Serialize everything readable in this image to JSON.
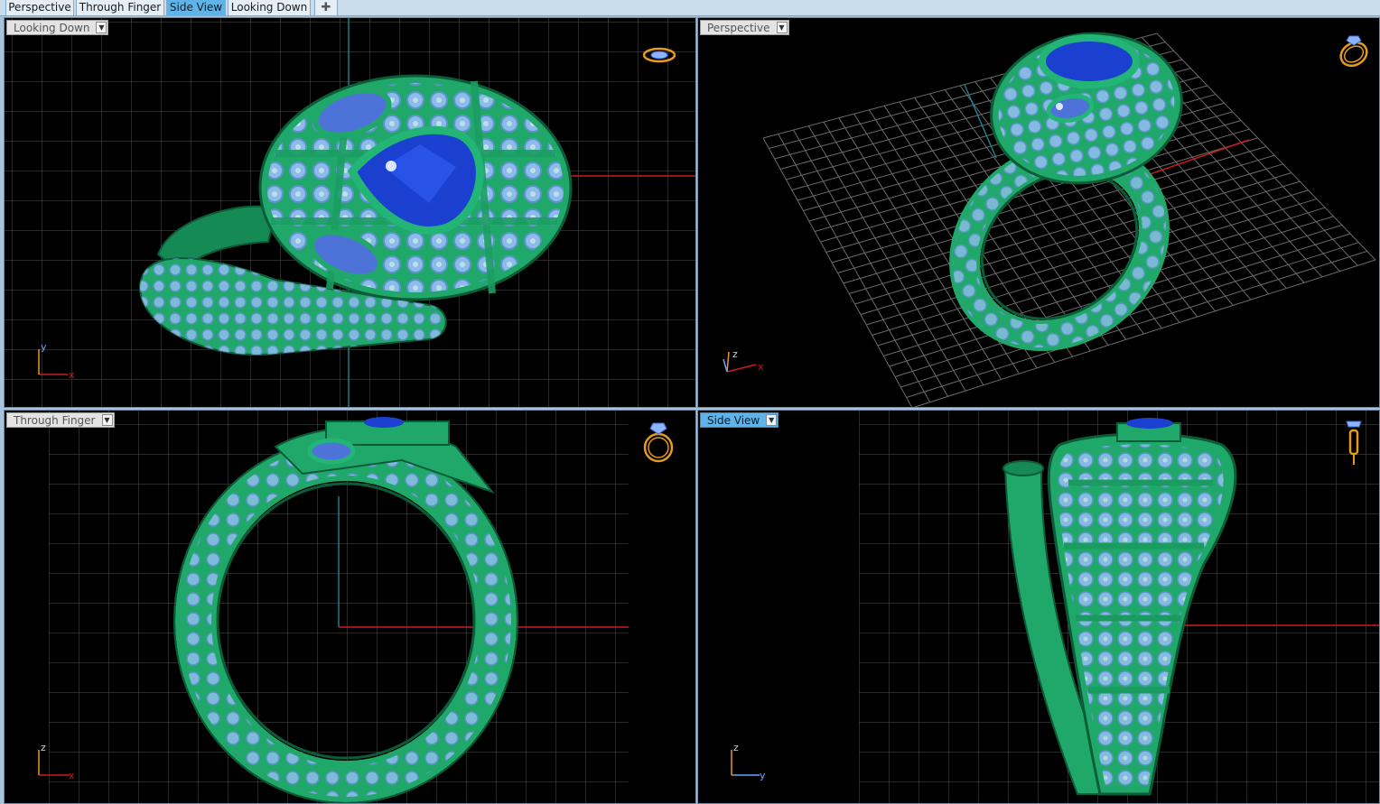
{
  "tabs": [
    {
      "label": "Perspective",
      "active": false
    },
    {
      "label": "Through Finger",
      "active": false
    },
    {
      "label": "Side View",
      "active": true
    },
    {
      "label": "Looking Down",
      "active": false
    }
  ],
  "add_tab_icon": "plus-icon",
  "viewports": {
    "top_left": {
      "label": "Looking Down",
      "axes": {
        "vertical": "y",
        "horizontal": "x"
      },
      "nav_icon": "ring-top-orientation-icon"
    },
    "top_right": {
      "label": "Perspective",
      "axes": {
        "vertical": "z",
        "horizontal": "x"
      },
      "nav_icon": "ring-perspective-orientation-icon"
    },
    "bottom_left": {
      "label": "Through Finger",
      "axes": {
        "vertical": "z",
        "horizontal": "x"
      },
      "nav_icon": "ring-front-orientation-icon"
    },
    "bottom_right": {
      "label": "Side View",
      "axes": {
        "vertical": "z",
        "horizontal": "y"
      },
      "nav_icon": "ring-side-orientation-icon"
    }
  },
  "colors": {
    "viewport_bg": "#000000",
    "grid": "#5a5a5a",
    "x_axis": "#c81e1e",
    "y_axis": "#1e7f8c",
    "metal": "#1fa86a",
    "accent_stone": "#8fb4ff",
    "center_stone": "#1b3fcf",
    "nav_widget": "#e59a1c",
    "active_tab": "#5fb3e6"
  }
}
